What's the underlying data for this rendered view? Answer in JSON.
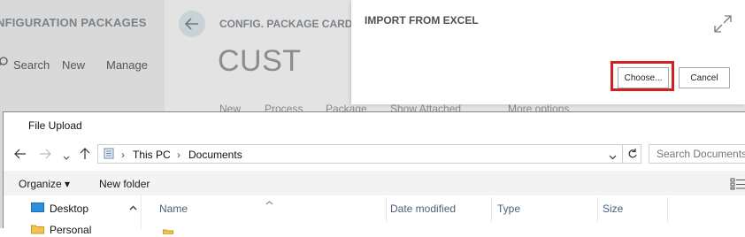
{
  "list_pane": {
    "title": "NFIGURATION PACKAGES",
    "actions": [
      "Search",
      "New",
      "Manage"
    ]
  },
  "card_pane": {
    "caption": "CONFIG. PACKAGE CARD",
    "title": "CUST",
    "actions": [
      "New",
      "Process",
      "Package",
      "Show Attached",
      "More options"
    ]
  },
  "import_dialog": {
    "title": "IMPORT FROM EXCEL",
    "choose_label": "Choose...",
    "cancel_label": "Cancel",
    "highlight_color": "#d42020"
  },
  "file_upload": {
    "title": "File Upload",
    "breadcrumb": [
      "This PC",
      "Documents"
    ],
    "search_placeholder": "Search Documents",
    "organize_label": "Organize ▾",
    "new_folder_label": "New folder",
    "tree": [
      "Desktop",
      "Personal"
    ],
    "columns": [
      "Name",
      "Date modified",
      "Type",
      "Size"
    ]
  }
}
